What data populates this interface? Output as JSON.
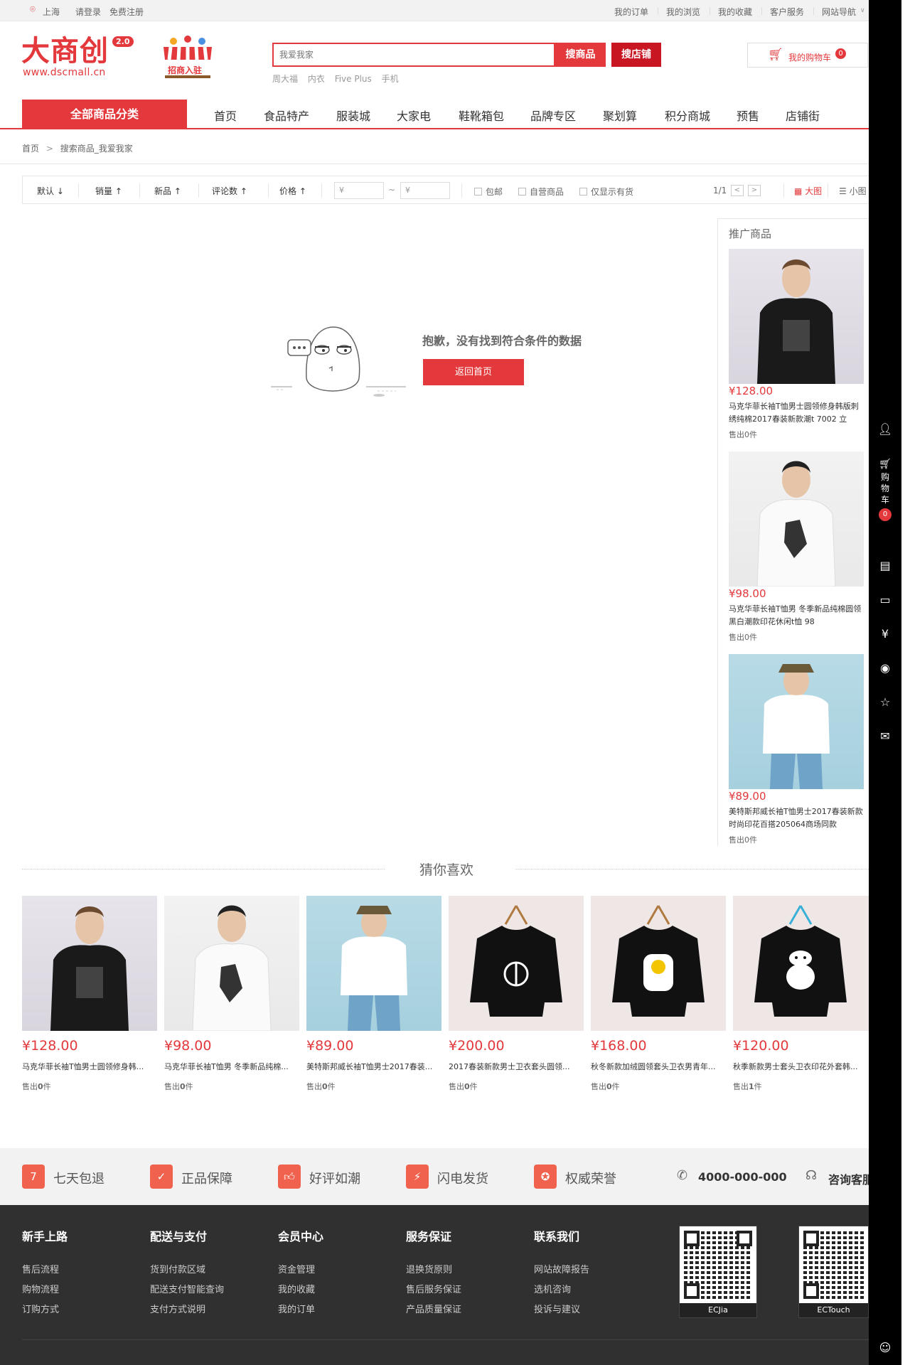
{
  "topbar": {
    "location": "上海",
    "login": "请登录",
    "register": "免费注册",
    "links": [
      "我的订单",
      "我的浏览",
      "我的收藏",
      "客户服务",
      "网站导航"
    ]
  },
  "header": {
    "logo": "大商创",
    "version": "2.0",
    "url": "www.dscmall.cn",
    "merchant_label": "招商入驻",
    "search_placeholder": "我爱我家",
    "search_goods": "搜商品",
    "search_shop": "搜店铺",
    "hotwords": [
      "周大福",
      "内衣",
      "Five Plus",
      "手机"
    ],
    "cart_label": "我的购物车",
    "cart_count": "0"
  },
  "nav": {
    "all_categories": "全部商品分类",
    "items": [
      "首页",
      "食品特产",
      "服装城",
      "大家电",
      "鞋靴箱包",
      "品牌专区",
      "聚划算",
      "积分商城",
      "预售",
      "店铺街"
    ]
  },
  "breadcrumb": {
    "home": "首页",
    "sep": ">",
    "current": "搜索商品_我爱我家"
  },
  "filter": {
    "sorts": [
      "默认",
      "销量",
      "新品",
      "评论数",
      "价格"
    ],
    "price_from": "¥",
    "price_to": "¥",
    "price_dash": "~",
    "checks": [
      "包邮",
      "自营商品",
      "仅显示有货"
    ],
    "page": "1/1",
    "view_big": "大图",
    "view_small": "小图"
  },
  "empty": {
    "message": "抱歉，没有找到符合条件的数据",
    "button": "返回首页"
  },
  "promo": {
    "title": "推广商品",
    "items": [
      {
        "price": "¥128.00",
        "name": "马克华菲长袖T恤男士圆领修身韩版刺绣纯棉2017春装新款潮t 7002 立",
        "sold_prefix": "售出",
        "sold": "0",
        "sold_suffix": "件"
      },
      {
        "price": "¥98.00",
        "name": "马克华菲长袖T恤男 冬季新品纯棉圆领黑白潮款印花休闲t恤 98",
        "sold_prefix": "售出",
        "sold": "0",
        "sold_suffix": "件"
      },
      {
        "price": "¥89.00",
        "name": "美特斯邦威长袖T恤男士2017春装新款时尚印花百搭205064商场同款",
        "sold_prefix": "售出",
        "sold": "0",
        "sold_suffix": "件"
      }
    ]
  },
  "guess": {
    "title": "猜你喜欢",
    "items": [
      {
        "price": "¥128.00",
        "name": "马克华菲长袖T恤男士圆领修身韩...",
        "sold_prefix": "售出",
        "sold": "0",
        "sold_suffix": "件"
      },
      {
        "price": "¥98.00",
        "name": "马克华菲长袖T恤男 冬季新品纯棉...",
        "sold_prefix": "售出",
        "sold": "0",
        "sold_suffix": "件"
      },
      {
        "price": "¥89.00",
        "name": "美特斯邦威长袖T恤男士2017春装...",
        "sold_prefix": "售出",
        "sold": "0",
        "sold_suffix": "件"
      },
      {
        "price": "¥200.00",
        "name": "2017春装新款男士卫衣套头圆领...",
        "sold_prefix": "售出",
        "sold": "0",
        "sold_suffix": "件"
      },
      {
        "price": "¥168.00",
        "name": "秋冬新款加绒圆领套头卫衣男青年...",
        "sold_prefix": "售出",
        "sold": "0",
        "sold_suffix": "件"
      },
      {
        "price": "¥120.00",
        "name": "秋季新款男士套头卫衣印花外套韩...",
        "sold_prefix": "售出",
        "sold": "1",
        "sold_suffix": "件"
      }
    ]
  },
  "service": {
    "items": [
      "七天包退",
      "正品保障",
      "好评如潮",
      "闪电发货",
      "权威荣誉"
    ],
    "phone": "4000-000-000",
    "online": "咨询客服"
  },
  "footer": {
    "columns": [
      {
        "title": "新手上路",
        "links": [
          "售后流程",
          "购物流程",
          "订购方式"
        ]
      },
      {
        "title": "配送与支付",
        "links": [
          "货到付款区域",
          "配送支付智能查询",
          "支付方式说明"
        ]
      },
      {
        "title": "会员中心",
        "links": [
          "资金管理",
          "我的收藏",
          "我的订单"
        ]
      },
      {
        "title": "服务保证",
        "links": [
          "退换货原则",
          "售后服务保证",
          "产品质量保证"
        ]
      },
      {
        "title": "联系我们",
        "links": [
          "网站故障报告",
          "选机咨询",
          "投诉与建议"
        ]
      }
    ],
    "qr": [
      "ECJia",
      "ECTouch"
    ]
  },
  "toolbar": {
    "cart_label": "购物车",
    "cart_count": "0"
  },
  "colors": {
    "accent": "#e4393c",
    "dark_red": "#c81623",
    "footer_bg": "#303030",
    "service_icon": "#f0624d"
  }
}
